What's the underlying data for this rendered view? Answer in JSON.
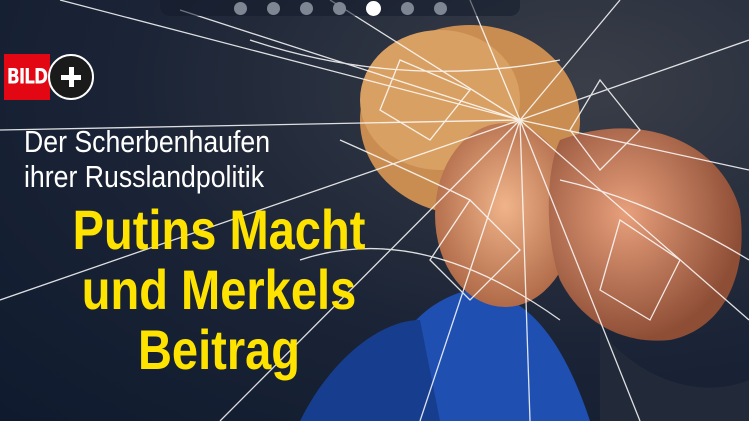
{
  "teaser": {
    "brand": "BILD",
    "plus_icon": "plus-icon",
    "kicker_lines": [
      "Der Scherbenhaufen",
      "ihrer Russlandpolitik"
    ],
    "headline_lines": [
      "Putins Macht",
      "und Merkels",
      "Beitrag"
    ],
    "colors": {
      "brand_red": "#e30613",
      "headline_yellow": "#ffe300",
      "kicker_white": "#ffffff"
    }
  },
  "carousel": {
    "total_slides": 7,
    "active_index": 4
  }
}
